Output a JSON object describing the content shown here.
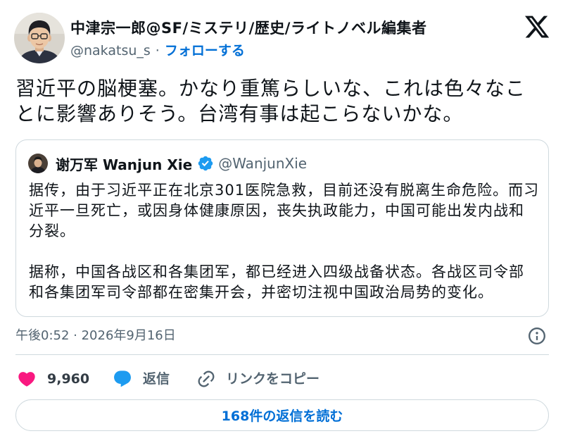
{
  "tweet": {
    "author": {
      "name": "中津宗一郎@SF/ミステリ/歴史/ライトノベル編集者",
      "handle": "@nakatsu_s",
      "separator": "·",
      "follow_label": "フォローする"
    },
    "text_lines": [
      "習近平の脳梗塞。かなり重篤らしいな、これは色々なこ",
      "とに影響ありそう。台湾有事は起こらないかな。"
    ],
    "quote": {
      "author_name": "谢万军 Wanjun Xie",
      "verified": true,
      "handle": "@WanjunXie",
      "paragraphs": [
        [
          "据传，由于习近平正在北京301医院急救，目前还没有脱离生命危险。而习",
          "近平一旦死亡，或因身体健康原因，丧失执政能力，中国可能出发内战和",
          "分裂。"
        ],
        [
          "据称，中国各战区和各集团军，都已经进入四级战备状态。各战区司令部",
          "和各集团军司令部都在密集开会，并密切注视中国政治局势的变化。"
        ]
      ]
    },
    "timestamp": "午後0:52 · 2026年9月16日",
    "actions": {
      "like_count": "9,960",
      "reply_label": "返信",
      "copy_link_label": "リンクをコピー"
    },
    "read_replies_label": "168件の返信を読む"
  },
  "icons": {
    "logo": "x-logo-icon",
    "verified": "verified-badge-icon",
    "info": "info-icon",
    "like": "heart-icon",
    "reply": "reply-icon",
    "copy_link": "link-icon"
  },
  "colors": {
    "link": "#006fd6",
    "verified": "#1d9bf0",
    "heart": "#f91880",
    "muted": "#536471",
    "border": "#cfd9de",
    "text": "#0f1419"
  }
}
